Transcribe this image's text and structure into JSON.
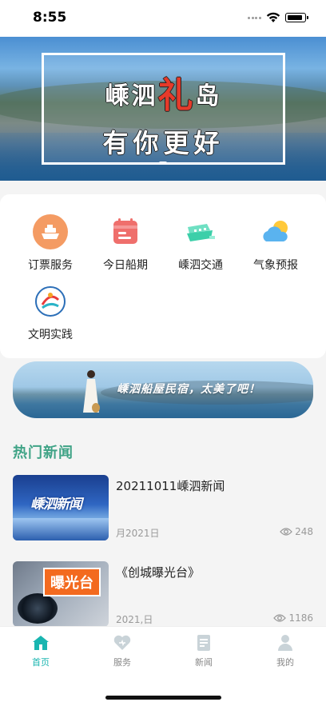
{
  "status_bar": {
    "time": "8:55"
  },
  "banner": {
    "line1_left": "嵊泗",
    "line1_red": "礼",
    "line1_right": "岛",
    "line2": "有你更好"
  },
  "services": [
    {
      "label": "订票服务",
      "icon": "ferry-ticket-icon"
    },
    {
      "label": "今日船期",
      "icon": "calendar-icon"
    },
    {
      "label": "嵊泗交通",
      "icon": "ship-icon"
    },
    {
      "label": "气象预报",
      "icon": "weather-icon"
    },
    {
      "label": "文明实践",
      "icon": "civilization-logo-icon"
    }
  ],
  "promo": {
    "text": "嵊泗船屋民宿，太美了吧！"
  },
  "news_section": {
    "title": "热门新闻"
  },
  "news": [
    {
      "title": "20211011嵊泗新闻",
      "date": "月2021日",
      "views": "248",
      "thumb_text": "嵊泗新闻"
    },
    {
      "title": "《创城曝光台》",
      "date": "2021,日",
      "views": "1186",
      "thumb_text": "曝光台"
    }
  ],
  "tabbar": [
    {
      "label": "首页",
      "icon": "home-icon",
      "active": true
    },
    {
      "label": "服务",
      "icon": "heart-icon",
      "active": false
    },
    {
      "label": "新闻",
      "icon": "news-icon",
      "active": false
    },
    {
      "label": "我的",
      "icon": "user-icon",
      "active": false
    }
  ],
  "colors": {
    "accent": "#19b5b0",
    "section_title": "#3fa386",
    "ticket_orange": "#f49b63",
    "calendar_red": "#ef6f6c",
    "transport_teal": "#3ccfa9",
    "weather_blue": "#5ab3ef"
  }
}
